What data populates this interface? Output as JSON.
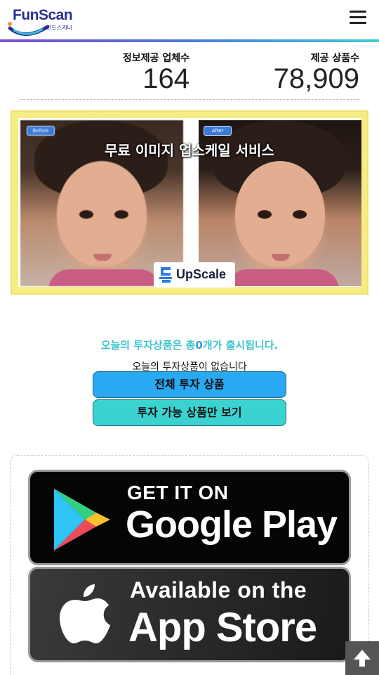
{
  "header": {
    "logo_text": "FunScan",
    "logo_subtext": "펀드스캐너",
    "menu_icon": "hamburger-menu-icon"
  },
  "stats": {
    "providers_label": "정보제공 업체수",
    "providers_value": "164",
    "products_label": "제공 상품수",
    "products_value": "78,909"
  },
  "banner": {
    "title": "무료 이미지 업스케일 서비스",
    "before_tag": "Before",
    "after_tag": "After",
    "badge_text": "UpScale",
    "colors": {
      "frame": "#f6ec84",
      "tag": "#3a7bd5"
    }
  },
  "invest": {
    "headline_prefix": "오늘의 투자상품은 총",
    "headline_count": "0",
    "headline_suffix": "개가 출시됩니다.",
    "empty_message": "오늘의 투자상품이 없습니다",
    "button_all": "전체 투자 상품",
    "button_available": "투자 가능 상품만 보기",
    "colors": {
      "headline": "#3ec3cf",
      "button_all": "#2aa8f2",
      "button_available": "#3ad3d0"
    }
  },
  "stores": {
    "google_small": "GET IT ON",
    "google_big": "Google Play",
    "apple_small": "Available on the",
    "apple_big": "App Store"
  },
  "scroll_top_icon": "arrow-up-icon"
}
